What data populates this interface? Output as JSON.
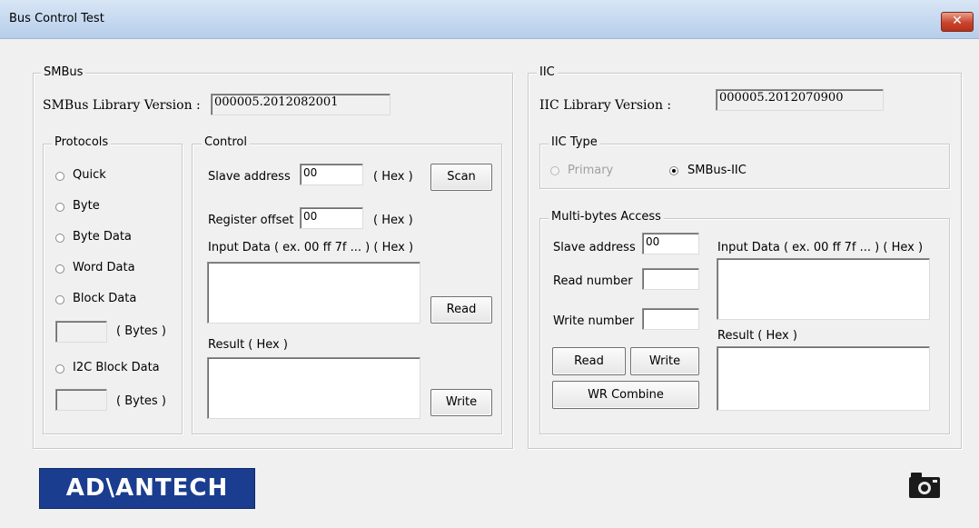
{
  "window": {
    "title": "Bus Control Test",
    "close_glyph": "✕"
  },
  "smbus": {
    "group_label": "SMBus",
    "library_version_label": "SMBus Library Version :",
    "library_version_value": "000005.2012082001",
    "protocols": {
      "group_label": "Protocols",
      "options": [
        "Quick",
        "Byte",
        "Byte Data",
        "Word Data",
        "Block Data",
        "I2C Block Data"
      ],
      "block_bytes_label": "( Bytes )",
      "i2c_bytes_label": "( Bytes )",
      "block_bytes_value": "",
      "i2c_bytes_value": ""
    },
    "control": {
      "group_label": "Control",
      "slave_address_label": "Slave address",
      "slave_address_value": "00",
      "register_offset_label": "Register offset",
      "register_offset_value": "00",
      "hex_label": "( Hex )",
      "input_data_label": "Input Data ( ex. 00 ff 7f ... ) ( Hex )",
      "input_data_value": "",
      "result_label": "Result ( Hex )",
      "result_value": "",
      "scan_button": "Scan",
      "read_button": "Read",
      "write_button": "Write"
    }
  },
  "iic": {
    "group_label": "IIC",
    "library_version_label": "IIC Library Version :",
    "library_version_value": "000005.2012070900",
    "type": {
      "group_label": "IIC Type",
      "primary_label": "Primary",
      "smbus_iic_label": "SMBus-IIC",
      "selected": "SMBus-IIC"
    },
    "multibyte": {
      "group_label": "Multi-bytes Access",
      "slave_address_label": "Slave address",
      "slave_address_value": "00",
      "read_number_label": "Read number",
      "read_number_value": "",
      "write_number_label": "Write number",
      "write_number_value": "",
      "input_data_label": "Input Data ( ex. 00 ff 7f ... ) ( Hex )",
      "input_data_value": "",
      "result_label": "Result ( Hex )",
      "result_value": "",
      "read_button": "Read",
      "write_button": "Write",
      "wr_combine_button": "WR Combine"
    }
  },
  "footer": {
    "logo_text": "AD\\ANTECH",
    "camera_icon": "camera-icon"
  },
  "colors": {
    "logo_bg": "#1a3d8f",
    "close_red": "#c9442d"
  }
}
